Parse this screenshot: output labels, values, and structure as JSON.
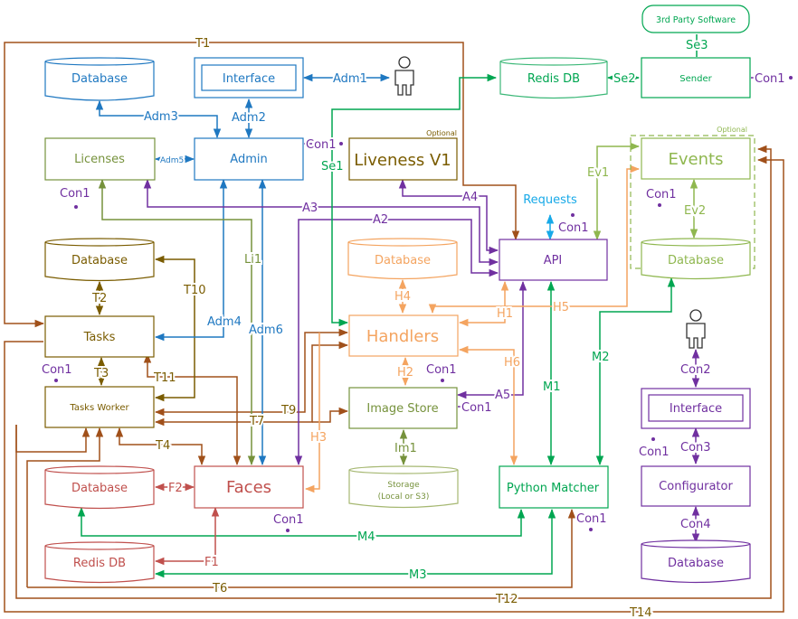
{
  "colors": {
    "blue": "#1f78c1",
    "olive": "#7a5c00",
    "green": "#00a651",
    "lightgreen": "#8fb74f",
    "orange": "#f4a460",
    "brown": "#a0501a",
    "purple": "#7030a0",
    "red": "#c0504d",
    "sky": "#17a9e8",
    "storage": "#8fa35a"
  },
  "nodes": {
    "db_admin": "Database",
    "interface_admin": "Interface",
    "admin": "Admin",
    "licenses": "Licenses",
    "liveness": "Liveness V1",
    "liveness_opt": "Optional",
    "redis_top": "Redis DB",
    "sender": "Sender",
    "third_party": "3rd Party Software",
    "events": "Events",
    "events_opt": "Optional",
    "events_db": "Database",
    "db_tasks": "Database",
    "tasks": "Tasks",
    "tasks_worker": "Tasks Worker",
    "db_handlers": "Database",
    "handlers": "Handlers",
    "api": "API",
    "requests": "Requests",
    "image_store": "Image Store",
    "storage_l1": "Storage",
    "storage_l2": "(Local or S3)",
    "db_faces": "Database",
    "faces": "Faces",
    "redis_faces": "Redis DB",
    "python_matcher": "Python Matcher",
    "interface_conf": "Interface",
    "configurator": "Configurator",
    "db_conf": "Database"
  },
  "labels": {
    "T1": "T1",
    "Adm1": "Adm1",
    "Adm2": "Adm2",
    "Adm3": "Adm3",
    "Adm4": "Adm4",
    "Adm5": "Adm5",
    "Adm6": "Adm6",
    "Con1": "Con1",
    "Con2": "Con2",
    "Con3": "Con3",
    "Con4": "Con4",
    "Se1": "Se1",
    "Se2": "Se2",
    "Se3": "Se3",
    "Ev1": "Ev1",
    "Ev2": "Ev2",
    "A2": "A2",
    "A3": "A3",
    "A4": "A4",
    "A5": "A5",
    "Li1": "Li1",
    "T2": "T2",
    "T3": "T3",
    "T4": "T4",
    "T6": "T6",
    "T7": "T7",
    "T9": "T9",
    "T10": "T10",
    "T11": "T11",
    "T12": "T12",
    "T14": "T14",
    "H1": "H1",
    "H2": "H2",
    "H3": "H3",
    "H4": "H4",
    "H5": "H5",
    "H6": "H6",
    "Im1": "Im1",
    "F1": "F1",
    "F2": "F2",
    "M1": "M1",
    "M2": "M2",
    "M3": "M3",
    "M4": "M4"
  }
}
